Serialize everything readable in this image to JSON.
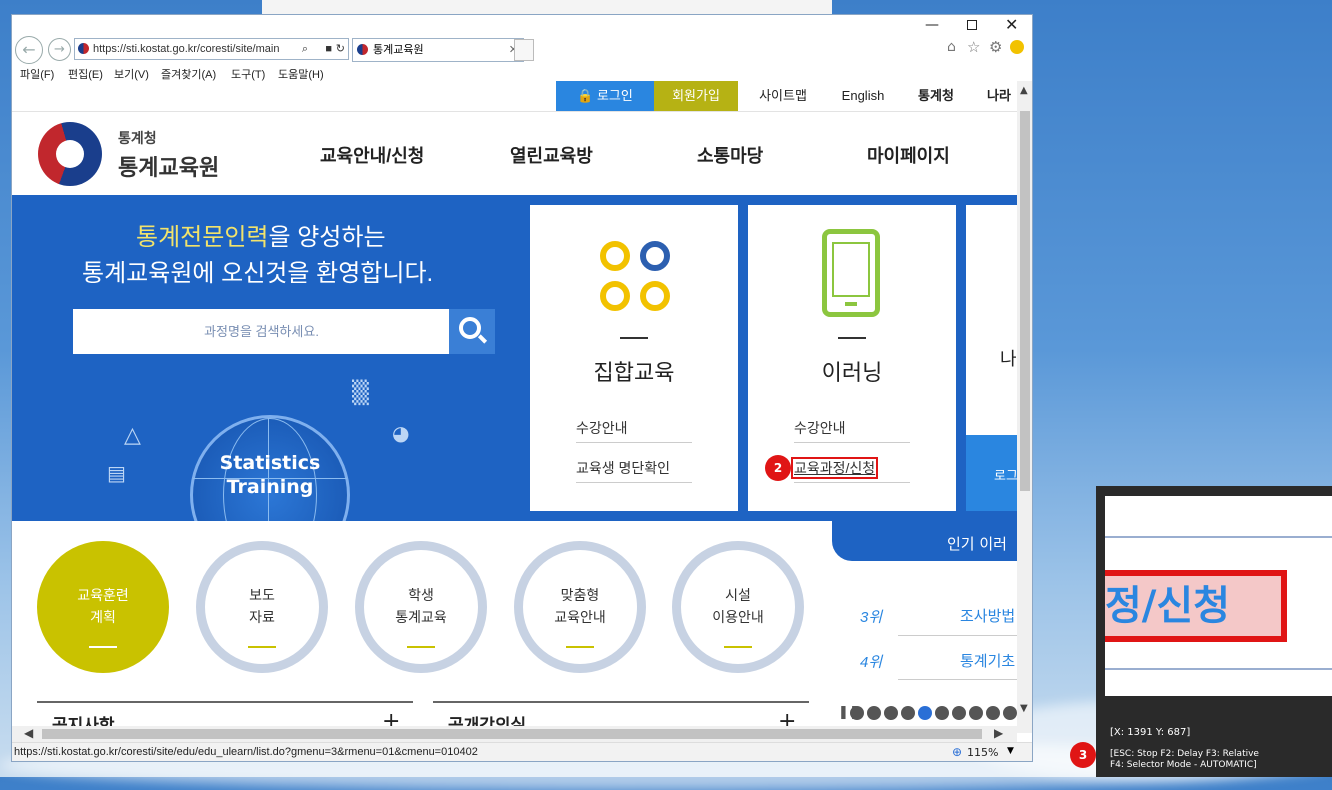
{
  "browser": {
    "url": "https://sti.kostat.go.kr/coresti/site/main",
    "tab_title": "통계교육원",
    "menu": [
      "파일(F)",
      "편집(E)",
      "보기(V)",
      "즐겨찾기(A)",
      "도구(T)",
      "도움말(H)"
    ],
    "status_url": "https://sti.kostat.go.kr/coresti/site/edu/edu_ulearn/list.do?gmenu=3&rmenu=01&cmenu=010402",
    "zoom": "115%"
  },
  "topnav": {
    "login": "로그인",
    "join": "회원가입",
    "sitemap": "사이트맵",
    "english": "English",
    "kostat": "통계청",
    "nara": "나라"
  },
  "logo": {
    "line1": "통계청",
    "line2": "통계교육원"
  },
  "main_menu": [
    "교육안내/신청",
    "열린교육방",
    "소통마당",
    "마이페이지"
  ],
  "hero": {
    "highlight": "통계전문인력",
    "line1_rest": "을 양성하는",
    "line2": "통계교육원에 오신것을 환영합니다.",
    "search_placeholder": "과정명을 검색하세요.",
    "globe_line1": "Statistics",
    "globe_line2": "Training"
  },
  "cards": [
    {
      "title": "집합교육",
      "links": [
        "수강안내",
        "교육생 명단확인"
      ]
    },
    {
      "title": "이러닝",
      "links": [
        "수강안내",
        "교육과정/신청"
      ]
    },
    {
      "title": "나",
      "links": [
        "로그"
      ]
    }
  ],
  "circles": [
    {
      "l1": "교육훈련",
      "l2": "계획"
    },
    {
      "l1": "보도",
      "l2": "자료"
    },
    {
      "l1": "학생",
      "l2": "통계교육"
    },
    {
      "l1": "맞춤형",
      "l2": "교육안내"
    },
    {
      "l1": "시설",
      "l2": "이용안내"
    }
  ],
  "popular": {
    "title": "인기 이러",
    "items": [
      {
        "rank": "3위",
        "name": "조사방법"
      },
      {
        "rank": "4위",
        "name": "통계기초"
      }
    ]
  },
  "bottom": {
    "notice": "공지사항",
    "lecture": "공개강의실",
    "plus": "+"
  },
  "overlay": {
    "zoom_text": "정/신청",
    "coords": "[X: 1391 Y: 687]",
    "hint1": "[ESC: Stop F2: Delay F3: Relative",
    "hint2": "F4: Selector Mode - AUTOMATIC]",
    "badge2": "2",
    "badge3": "3"
  },
  "colors": {
    "accent_blue": "#1e63c3",
    "accent_yellow": "#c9c200",
    "highlight_red": "#e01515"
  }
}
